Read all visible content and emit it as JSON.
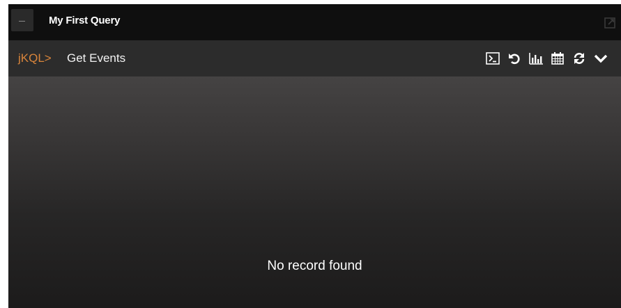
{
  "window": {
    "title": "My First Query"
  },
  "query_bar": {
    "prefix": "jKQL>",
    "query_name": "Get Events",
    "toolbar": [
      {
        "name": "console-icon"
      },
      {
        "name": "undo-icon"
      },
      {
        "name": "bar-chart-icon"
      },
      {
        "name": "calendar-icon"
      },
      {
        "name": "refresh-icon"
      },
      {
        "name": "chevron-down-icon"
      }
    ]
  },
  "content": {
    "empty_message": "No record found"
  },
  "colors": {
    "accent": "#d9853b",
    "title_bar_bg": "#0f0f0f",
    "query_bar_bg": "#2c2c2c",
    "text": "#ffffff"
  }
}
